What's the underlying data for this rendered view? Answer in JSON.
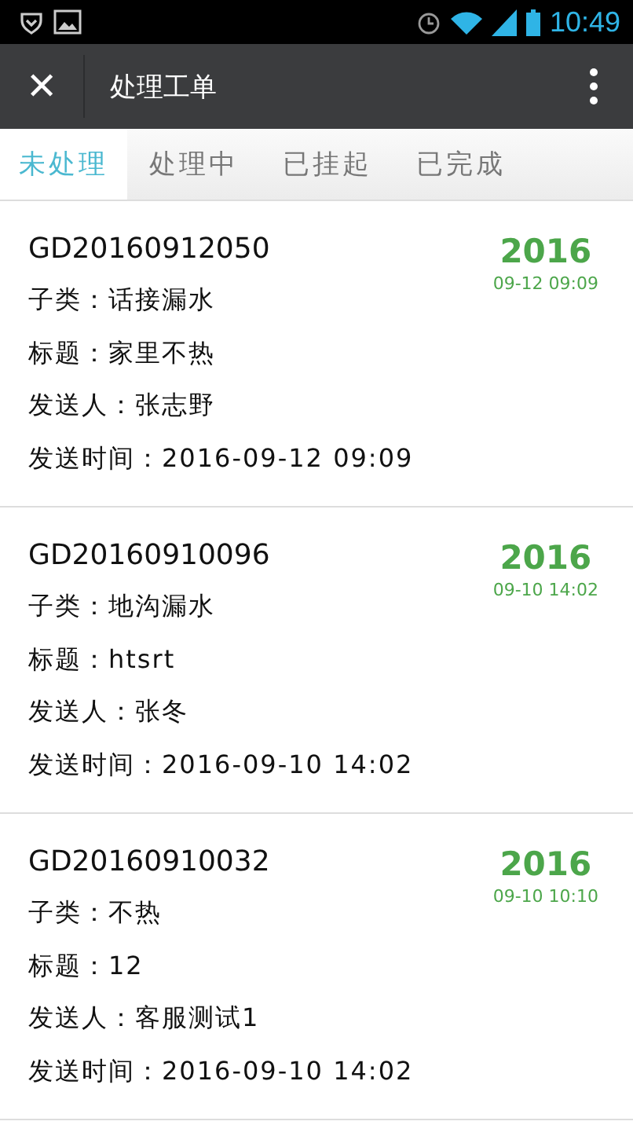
{
  "status_bar": {
    "time": "10:49"
  },
  "app_bar": {
    "close_icon": "✕",
    "title": "处理工单"
  },
  "tabs": [
    {
      "label": "未处理",
      "selected": true
    },
    {
      "label": "处理中",
      "selected": false
    },
    {
      "label": "已挂起",
      "selected": false
    },
    {
      "label": "已完成",
      "selected": false
    }
  ],
  "orders": [
    {
      "number": "GD20160912050",
      "year": "2016",
      "date": "09-12 09:09",
      "fields": [
        "子类：话接漏水",
        "标题：家里不热",
        "发送人：张志野",
        "发送时间：2016-09-12 09:09"
      ]
    },
    {
      "number": "GD20160910096",
      "year": "2016",
      "date": "09-10 14:02",
      "fields": [
        "子类：地沟漏水",
        "标题：htsrt",
        "发送人：张冬",
        "发送时间：2016-09-10 14:02"
      ]
    },
    {
      "number": "GD20160910032",
      "year": "2016",
      "date": "09-10 10:10",
      "fields": [
        "子类：不热",
        "标题：12",
        "发送人：客服测试1",
        "发送时间：2016-09-10 14:02"
      ]
    }
  ]
}
